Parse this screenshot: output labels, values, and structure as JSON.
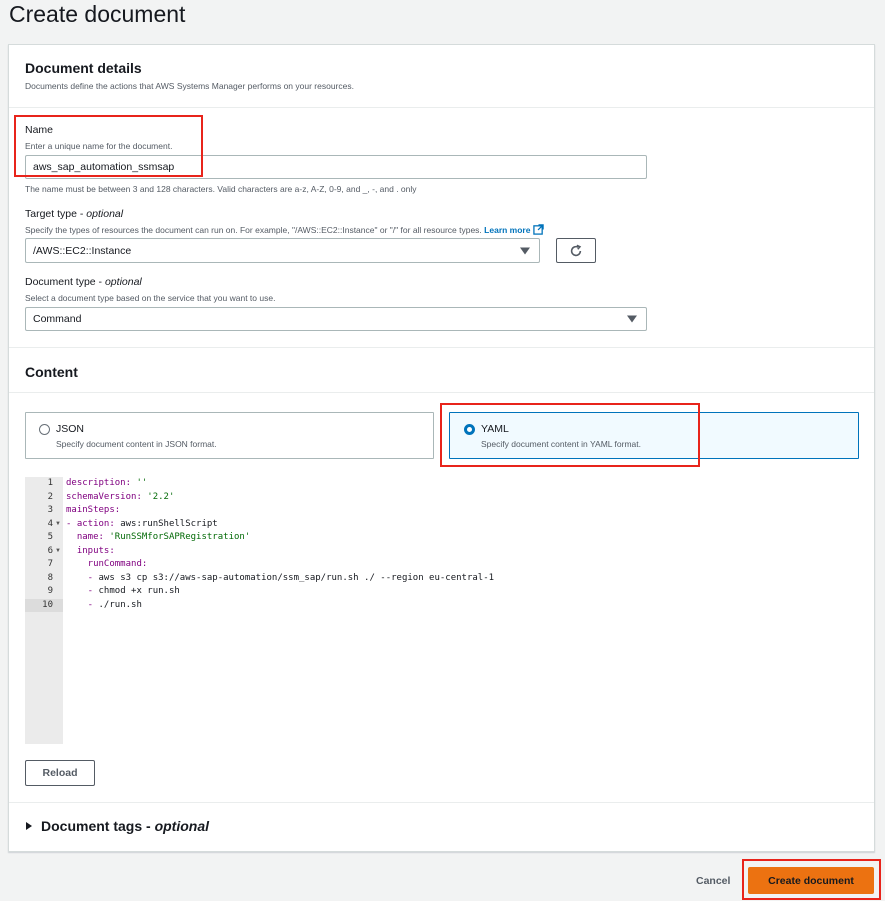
{
  "page": {
    "title": "Create document"
  },
  "details": {
    "heading": "Document details",
    "description": "Documents define the actions that AWS Systems Manager performs on your resources.",
    "name": {
      "label": "Name",
      "hint": "Enter a unique name for the document.",
      "value": "aws_sap_automation_ssmsap",
      "constraint": "The name must be between 3 and 128 characters. Valid characters are a-z, A-Z, 0-9, and _, -, and . only"
    },
    "target_type": {
      "label": "Target type",
      "optional": "optional",
      "hint": "Specify the types of resources the document can run on. For example, \"/AWS::EC2::Instance\" or \"/\" for all resource types.",
      "learn_more": "Learn more",
      "value": "/AWS::EC2::Instance"
    },
    "document_type": {
      "label": "Document type",
      "optional": "optional",
      "hint": "Select a document type based on the service that you want to use.",
      "value": "Command"
    }
  },
  "content": {
    "heading": "Content",
    "formats": [
      {
        "title": "JSON",
        "description": "Specify document content in JSON format.",
        "selected": false
      },
      {
        "title": "YAML",
        "description": "Specify document content in YAML format.",
        "selected": true
      }
    ],
    "code_lines": [
      {
        "num": "1",
        "text": "description: ''"
      },
      {
        "num": "2",
        "text": "schemaVersion: '2.2'"
      },
      {
        "num": "3",
        "text": "mainSteps:"
      },
      {
        "num": "4",
        "text": "- action: aws:runShellScript"
      },
      {
        "num": "5",
        "text": "  name: 'RunSSMforSAPRegistration'"
      },
      {
        "num": "6",
        "text": "  inputs:"
      },
      {
        "num": "7",
        "text": "    runCommand:"
      },
      {
        "num": "8",
        "text": "    - aws s3 cp s3://aws-sap-automation/ssm_sap/run.sh ./ --region eu-central-1"
      },
      {
        "num": "9",
        "text": "    - chmod +x run.sh"
      },
      {
        "num": "10",
        "text": "    - ./run.sh"
      }
    ],
    "reload_label": "Reload"
  },
  "tags": {
    "label": "Document tags",
    "optional": "optional"
  },
  "footer": {
    "cancel_label": "Cancel",
    "create_label": "Create document"
  },
  "colors": {
    "primary": "#ec7211",
    "highlight": "#e8241b",
    "link": "#0073bb"
  },
  "icons": {
    "refresh": "refresh-icon",
    "external": "external-link-icon",
    "caret": "caret-right-icon"
  }
}
